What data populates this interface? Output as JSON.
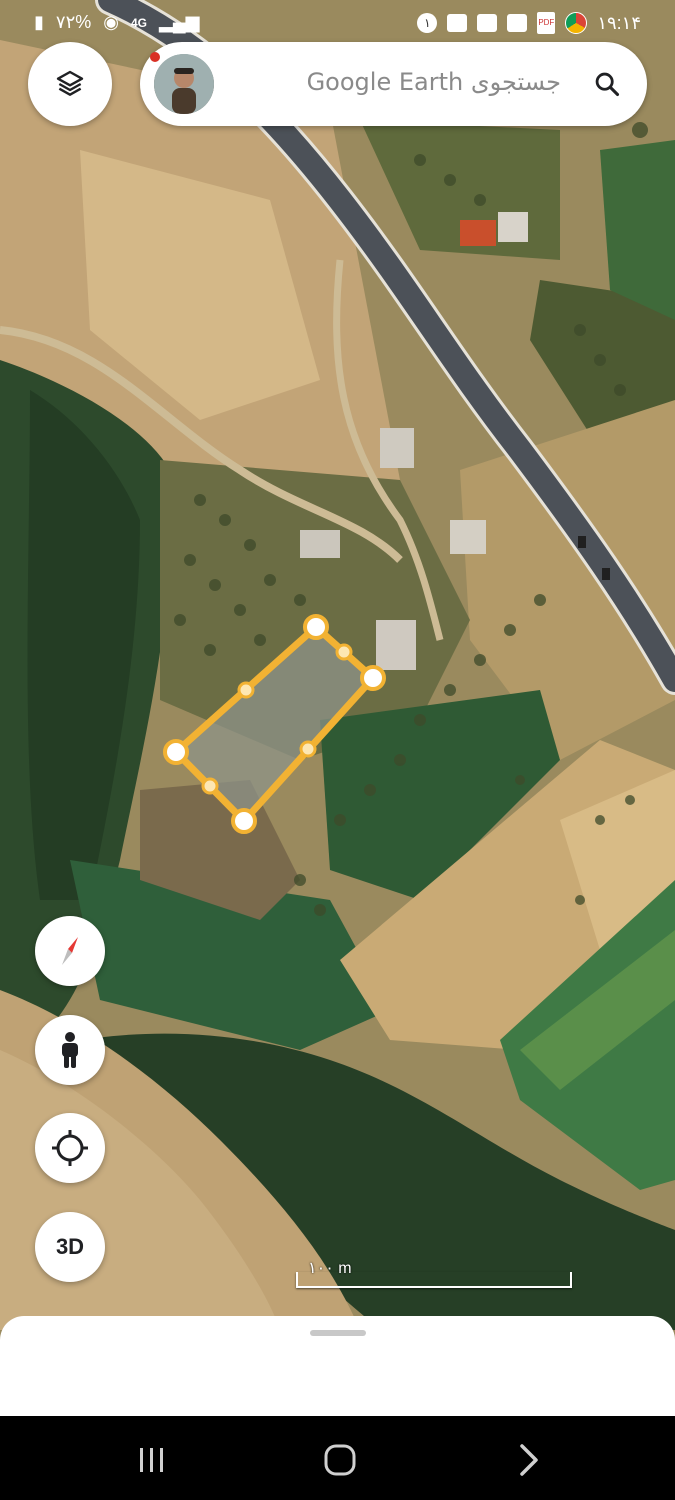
{
  "status_bar": {
    "battery_percent": "۷۲%",
    "network": "4G",
    "notification_count": "۱",
    "time": "۱۹:۱۴"
  },
  "search": {
    "placeholder": "جستجوی Google Earth"
  },
  "map": {
    "scale_label": "۱۰۰ m",
    "polygon_color": "#f2b233",
    "road_color": "#4c5158"
  },
  "controls": {
    "three_d_label": "3D",
    "icons": [
      "layers-icon",
      "compass-icon",
      "pegman-icon",
      "my-location-icon",
      "search-icon"
    ]
  },
  "nav": {
    "icons": [
      "recent-apps-icon",
      "home-icon",
      "back-icon"
    ]
  }
}
